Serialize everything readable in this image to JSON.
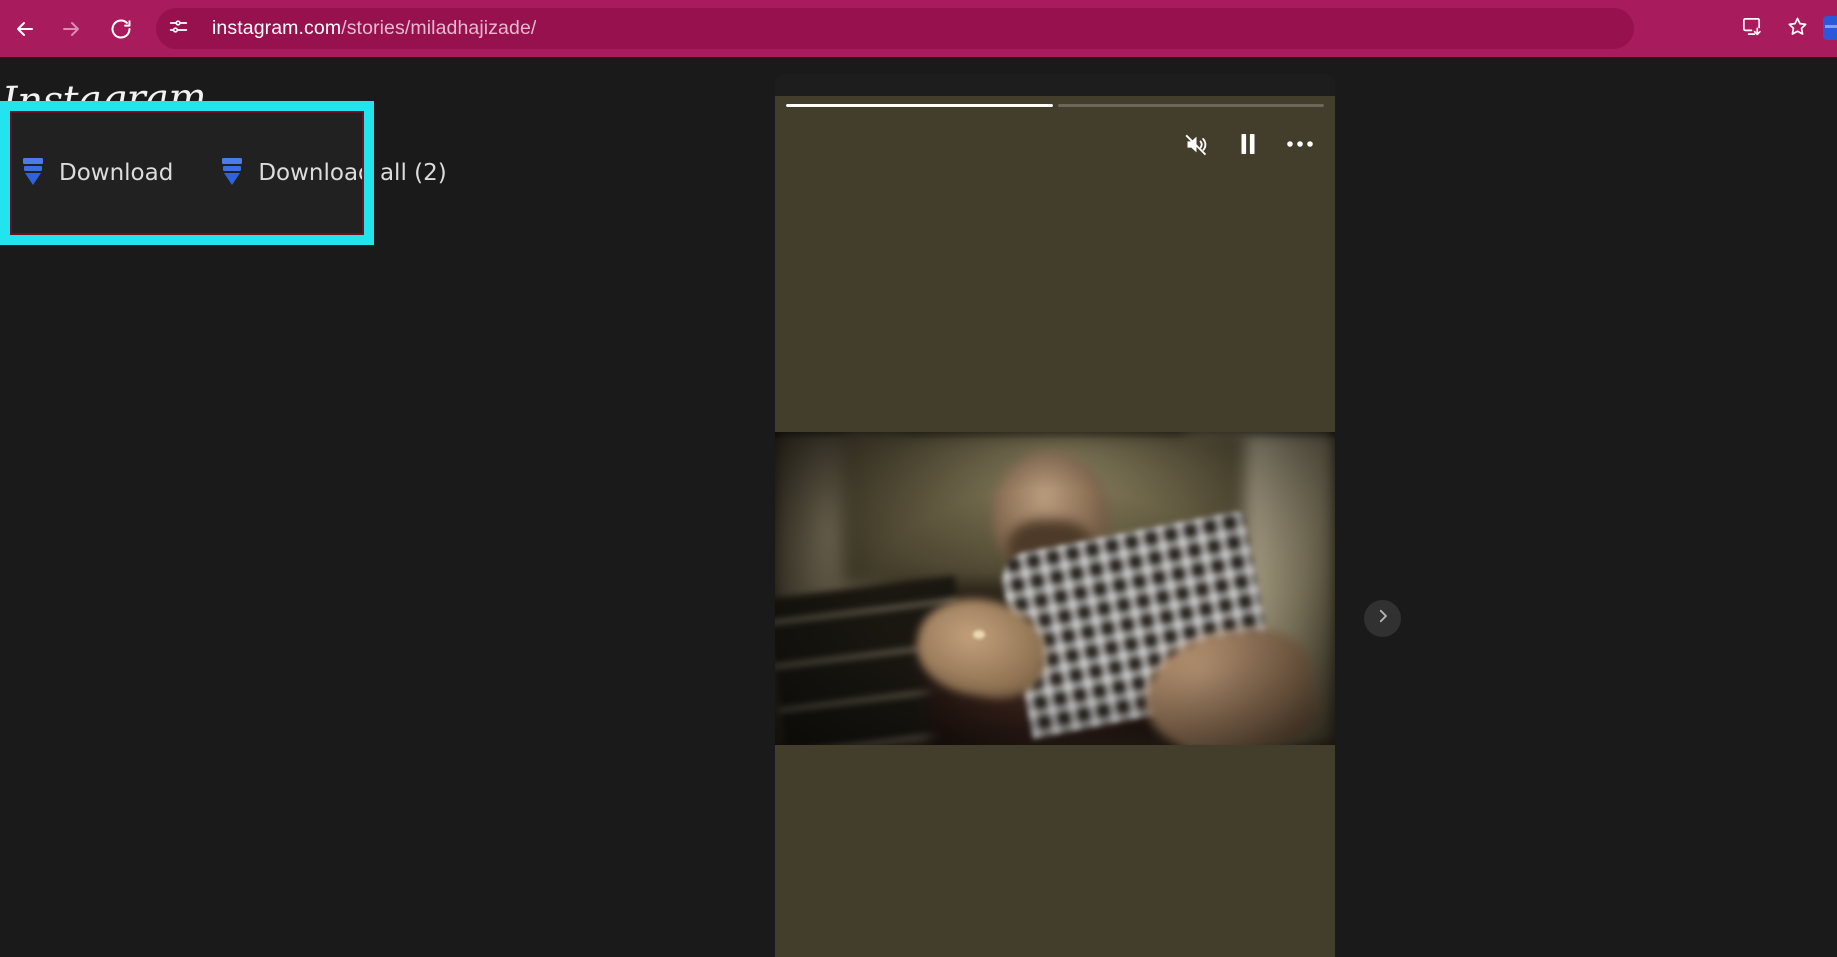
{
  "browser": {
    "back_icon": "arrow-left-icon",
    "forward_icon": "arrow-right-icon",
    "reload_icon": "reload-icon",
    "site_settings_icon": "tune-sliders-icon",
    "url_host": "instagram.com",
    "url_path": "/stories/miladhajizade/",
    "url_full": "instagram.com/stories/miladhajizade/",
    "install_icon": "install-app-icon",
    "bookmark_icon": "bookmark-star-icon",
    "chrome_bg": "#a81b5d",
    "omnibox_bg": "#97114f"
  },
  "page": {
    "brand": "Instagram",
    "background": "#1a1a1a"
  },
  "download_overlay": {
    "highlight_color": "#22e4ef",
    "inner_border_color": "#6b1020",
    "background": "#212121",
    "icon_color": "#3b6fe0",
    "actions": [
      {
        "label": "Download",
        "icon": "download-arrow-icon"
      },
      {
        "label": "Download all (2)",
        "icon": "download-arrow-icon"
      }
    ]
  },
  "story": {
    "progress_segments": [
      {
        "percent": 100
      },
      {
        "percent": 0
      }
    ],
    "controls": [
      {
        "name": "mute-icon",
        "label": "Mute"
      },
      {
        "name": "pause-icon",
        "label": "Pause"
      },
      {
        "name": "more-options-icon",
        "label": "More options"
      }
    ],
    "next_button_icon": "chevron-right-icon",
    "media_background": "#433d2c"
  }
}
